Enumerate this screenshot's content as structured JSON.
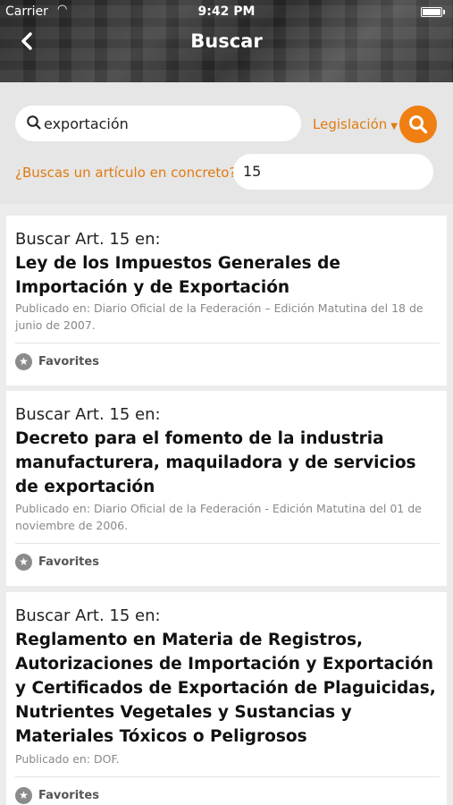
{
  "status_bar": {
    "carrier": "Carrier",
    "time": "9:42 PM"
  },
  "header": {
    "title": "Buscar",
    "back_icon": "chevron-left-icon"
  },
  "search": {
    "query": "exportación",
    "filter_label": "Legislación",
    "article_prompt": "¿Buscas un artículo en concreto?",
    "article_value": "15"
  },
  "results": [
    {
      "prefix": "Buscar Art. 15 en:",
      "title": "Ley de los Impuestos Generales de Importación y de Exportación",
      "published": "Publicado en: Diario Oficial de la Federación – Edición Matutina del 18 de junio de 2007.",
      "favorites_label": "Favorites"
    },
    {
      "prefix": "Buscar Art. 15 en:",
      "title": "Decreto para el fomento de la industria manufacturera, maquiladora y de servicios de exportación",
      "published": "Publicado en: Diario Oficial de la Federación - Edición Matutina del 01 de noviembre de 2006.",
      "favorites_label": "Favorites"
    },
    {
      "prefix": "Buscar Art. 15 en:",
      "title": "Reglamento en Materia de Registros, Autorizaciones de Importación y Exportación y Certificados de Exportación de Plaguicidas, Nutrientes Vegetales y Sustancias y Materiales Tóxicos o Peligrosos",
      "published": "Publicado en: DOF.",
      "favorites_label": "Favorites"
    }
  ],
  "colors": {
    "accent": "#ef7f12",
    "link": "#e07b10"
  }
}
